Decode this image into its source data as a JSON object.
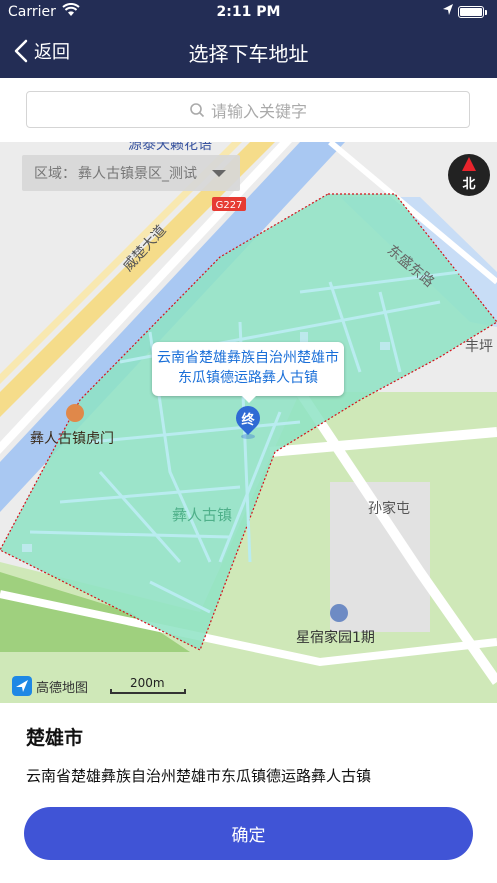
{
  "status_bar": {
    "carrier": "Carrier",
    "time": "2:11 PM"
  },
  "nav": {
    "back_label": "返回",
    "title": "选择下车地址"
  },
  "search": {
    "placeholder": "请输入关键字"
  },
  "map": {
    "region_prefix": "区域：",
    "region_value": "彝人古镇景区_测试",
    "compass_label": "北",
    "labels": {
      "top_poi": "源泰天籁花语",
      "road_g227": "G227",
      "weichu_road": "威楚大道",
      "dongsheng_road": "东盛东路",
      "fengping": "丰坪",
      "tiger_gate": "彝人古镇虎门",
      "yiren_town": "彝人古镇",
      "sunjiatun": "孙家屯",
      "xingsu": "星宿家园1期"
    },
    "address_bubble": "云南省楚雄彝族自治州楚雄市东瓜镇德运路彝人古镇",
    "end_marker": "终",
    "amap_logo": "高德地图",
    "scale": "200m",
    "colors": {
      "zone_fill": "#8ee3c4",
      "zone_border": "#d4121a",
      "accent": "#4054d6"
    }
  },
  "info": {
    "city": "楚雄市",
    "address": "云南省楚雄彝族自治州楚雄市东瓜镇德运路彝人古镇",
    "confirm_label": "确定"
  }
}
